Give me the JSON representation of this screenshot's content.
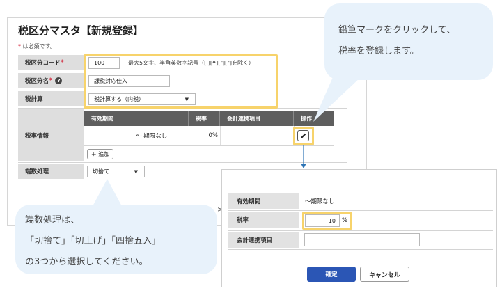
{
  "page": {
    "title": "税区分マスタ【新規登録】",
    "required_mark": "*",
    "required_note": "は必須です。"
  },
  "form": {
    "code": {
      "label": "税区分コード",
      "value": "100",
      "hint": "最大5文字、半角英数字記号（[,][¥][\"][\"]を除く）"
    },
    "name": {
      "label": "税区分名",
      "value": "課税対応仕入",
      "help_icon": "question-circle-icon"
    },
    "calc": {
      "label": "税計算",
      "value": "税計算する（内税）"
    },
    "rate_info": {
      "label": "税率情報",
      "columns": [
        "有効期間",
        "税率",
        "会計連携項目",
        "操作"
      ],
      "rows": [
        {
          "period": "〜 期限なし",
          "rate": "0%",
          "account": "",
          "action_icon": "pencil-icon"
        }
      ],
      "add_button": "＋ 追加"
    },
    "rounding": {
      "label": "端数処理",
      "value": "切捨て"
    }
  },
  "pager_fragment": ">",
  "bubbles": {
    "top_right": [
      "鉛筆マークをクリックして、",
      "税率を登録します。"
    ],
    "bottom_left": [
      "端数処理は、",
      "「切捨て」「切上げ」「四捨五入」",
      "の3つから選択してください。"
    ]
  },
  "popup": {
    "period_label": "有効期間",
    "period_value": "〜期限なし",
    "rate_label": "税率",
    "rate_value": "10",
    "rate_unit": "%",
    "account_label": "会計連携項目",
    "account_value": "",
    "confirm": "確定",
    "cancel": "キャンセル"
  },
  "colors": {
    "highlight": "#f7d36b",
    "primary_button": "#2b56b5",
    "arrow": "#2e74b5",
    "bubble": "#e8f2fb"
  }
}
